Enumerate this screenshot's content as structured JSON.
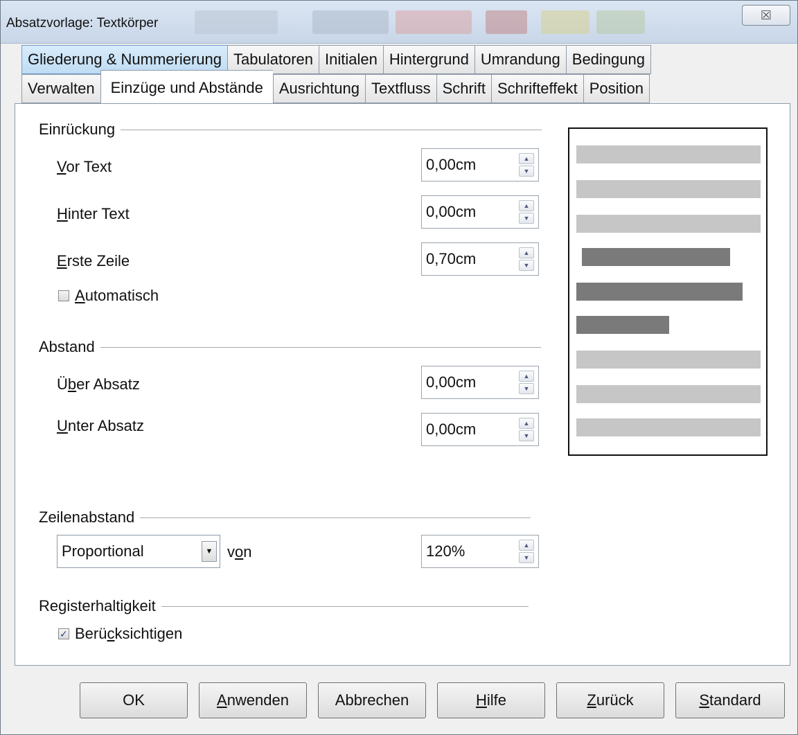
{
  "window": {
    "title": "Absatzvorlage: Textkörper",
    "close_glyph": "☒"
  },
  "tabs_row1": [
    {
      "label": "Gliederung & Nummerierung"
    },
    {
      "label": "Tabulatoren"
    },
    {
      "label": "Initialen"
    },
    {
      "label": "Hintergrund"
    },
    {
      "label": "Umrandung"
    },
    {
      "label": "Bedingung"
    }
  ],
  "tabs_row2": [
    {
      "label": "Verwalten"
    },
    {
      "label": "Einzüge und Abstände"
    },
    {
      "label": "Ausrichtung"
    },
    {
      "label": "Textfluss"
    },
    {
      "label": "Schrift"
    },
    {
      "label": "Schrifteffekt"
    },
    {
      "label": "Position"
    }
  ],
  "active_tab": "Einzüge und Abstände",
  "hovered_tab": "Gliederung & Nummerierung",
  "indent": {
    "heading": "Einrückung",
    "before_text": {
      "label_accel": "V",
      "label_rest": "or Text",
      "value": "0,00cm"
    },
    "after_text": {
      "label_accel": "H",
      "label_rest": "inter Text",
      "value": "0,00cm"
    },
    "first_line": {
      "label_accel": "E",
      "label_rest": "rste Zeile",
      "value": "0,70cm"
    },
    "automatic": {
      "label_accel": "A",
      "label_rest": "utomatisch",
      "checked": false
    }
  },
  "spacing": {
    "heading": "Abstand",
    "above": {
      "label_pre": "Ü",
      "label_accel": "b",
      "label_rest": "er Absatz",
      "value": "0,00cm"
    },
    "below": {
      "label_accel": "U",
      "label_rest": "nter Absatz",
      "value": "0,00cm"
    }
  },
  "line_spacing": {
    "heading": "Zeilenabstand",
    "mode": "Proportional",
    "of_pre": "v",
    "of_accel": "o",
    "of_rest": "n",
    "value": "120%"
  },
  "register": {
    "heading": "Registerhaltigkeit",
    "respect": {
      "label_pre": "Berü",
      "label_accel": "c",
      "label_rest": "ksichtigen",
      "checked": true
    }
  },
  "buttons": {
    "ok": "OK",
    "apply_accel": "A",
    "apply_rest": "nwenden",
    "cancel": "Abbrechen",
    "help_accel": "H",
    "help_rest": "ilfe",
    "back_accel": "Z",
    "back_rest": "urück",
    "default_accel": "S",
    "default_rest": "tandard"
  },
  "colors": {
    "preview_light": "#c6c6c6",
    "preview_dark": "#7a7a7a",
    "tab_hover": "#bfdcf3"
  }
}
